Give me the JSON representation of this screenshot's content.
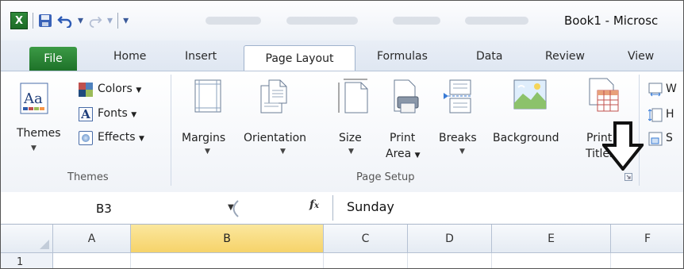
{
  "window": {
    "title": "Book1 - Microsc"
  },
  "tabs": [
    {
      "label": "File"
    },
    {
      "label": "Home"
    },
    {
      "label": "Insert"
    },
    {
      "label": "Page Layout"
    },
    {
      "label": "Formulas"
    },
    {
      "label": "Data"
    },
    {
      "label": "Review"
    },
    {
      "label": "View"
    }
  ],
  "ribbon": {
    "themes": {
      "group_label": "Themes",
      "themes_button": "Themes",
      "colors": "Colors",
      "fonts": "Fonts",
      "effects": "Effects"
    },
    "page_setup": {
      "group_label": "Page Setup",
      "margins": "Margins",
      "orientation": "Orientation",
      "size": "Size",
      "print_area_1": "Print",
      "print_area_2": "Area",
      "breaks": "Breaks",
      "background": "Background",
      "print_titles_1": "Print",
      "print_titles_2": "Titles"
    },
    "scale_partial": {
      "w": "W",
      "h": "H",
      "s": "S"
    }
  },
  "formula_bar": {
    "name_box": "B3",
    "fx": "fx",
    "formula": "Sunday"
  },
  "grid": {
    "columns": [
      "A",
      "B",
      "C",
      "D",
      "E",
      "F"
    ],
    "selected_column": "B",
    "rows": [
      "1"
    ]
  },
  "colors": {
    "accent": "#217346",
    "selected_header": "#f6d36a"
  }
}
